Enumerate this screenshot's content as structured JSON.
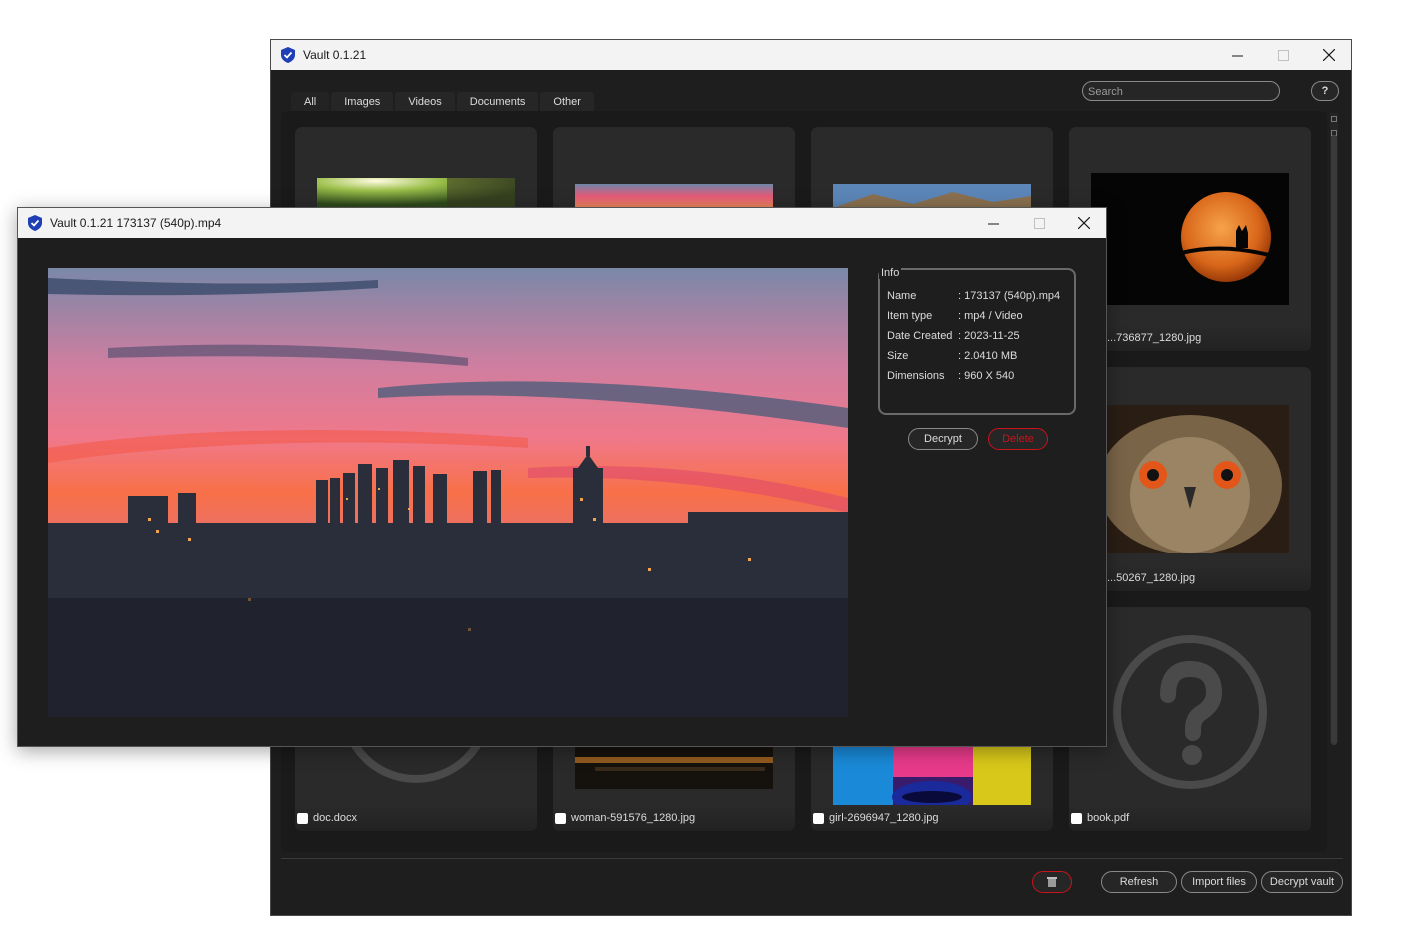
{
  "main_window": {
    "title": "Vault 0.1.21",
    "tabs": [
      "All",
      "Images",
      "Videos",
      "Documents",
      "Other"
    ],
    "active_tab": "All",
    "search_placeholder": "Search",
    "help_label": "?",
    "items": [
      {
        "name": "",
        "thumb": "forest-image"
      },
      {
        "name": "",
        "thumb": "sunset-image"
      },
      {
        "name": "",
        "thumb": "mountain-image"
      },
      {
        "name": "...736877_1280.jpg",
        "thumb": "moon-cat-image"
      },
      {
        "name": "...50267_1280.jpg",
        "thumb": "owl-image"
      },
      {
        "name": "doc.docx",
        "thumb": "unknown-file-icon"
      },
      {
        "name": "woman-591576_1280.jpg",
        "thumb": "pier-image"
      },
      {
        "name": "girl-2696947_1280.jpg",
        "thumb": "painted-face-image"
      },
      {
        "name": "book.pdf",
        "thumb": "unknown-file-icon"
      }
    ],
    "footer": {
      "delete_icon": "trash-icon",
      "refresh_label": "Refresh",
      "import_label": "Import files",
      "decrypt_vault_label": "Decrypt vault"
    }
  },
  "viewer_window": {
    "title": "Vault 0.1.21 173137 (540p).mp4",
    "info_title": "Info",
    "info": [
      {
        "label": "Name",
        "value": ": 173137 (540p).mp4"
      },
      {
        "label": "Item type",
        "value": ": mp4 / Video"
      },
      {
        "label": "Date Created",
        "value": ": 2023-11-25"
      },
      {
        "label": "Size",
        "value": ": 2.0410 MB"
      },
      {
        "label": "Dimensions",
        "value": ": 960 X 540"
      }
    ],
    "decrypt_label": "Decrypt",
    "delete_label": "Delete"
  },
  "colors": {
    "accent_blue": "#2f6bd8",
    "danger_red": "#c8141a",
    "window_bg": "#1e1e1e",
    "card_bg": "#2a2a2a"
  }
}
